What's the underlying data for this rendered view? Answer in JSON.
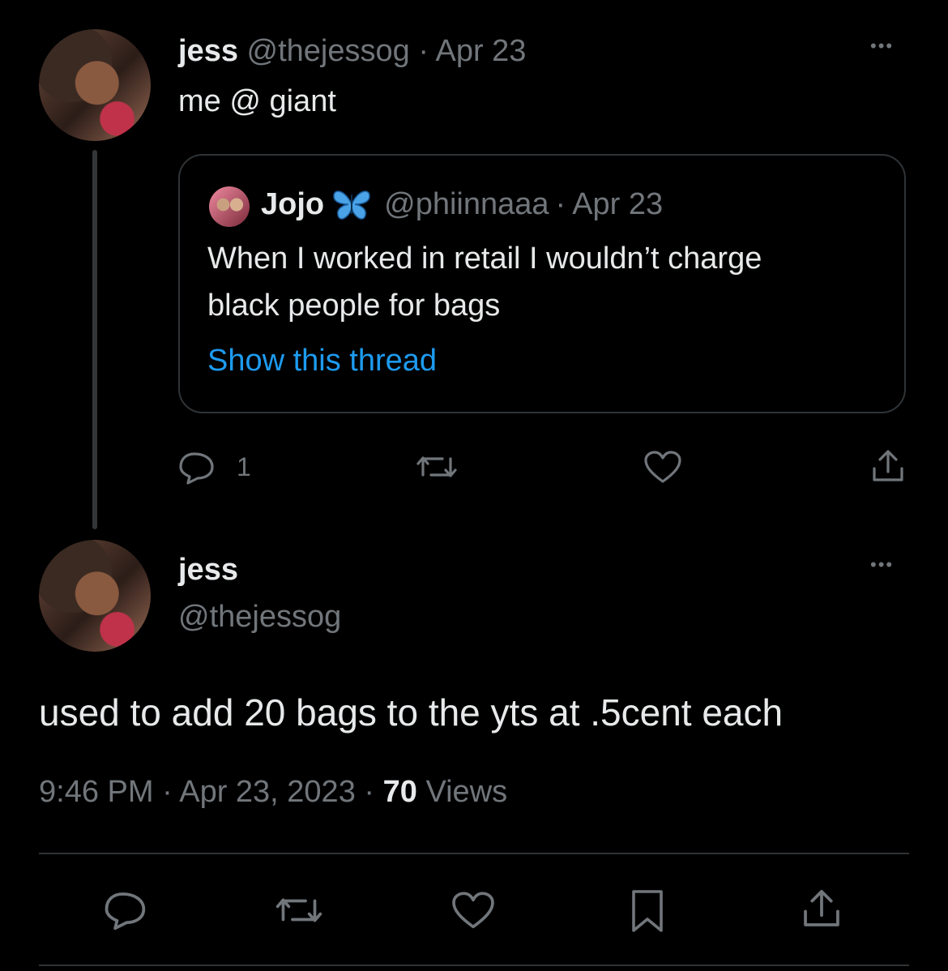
{
  "tweet1": {
    "name": "jess",
    "handle": "@thejessog",
    "sep": "·",
    "date": "Apr 23",
    "text": "me @ giant",
    "more": "•••",
    "quote": {
      "name": "Jojo",
      "handle": "@phiinnaaa",
      "sep": "·",
      "date": "Apr 23",
      "line1": "When I worked in retail I wouldn’t charge",
      "line2": "black people for bags",
      "show_thread": "Show this thread"
    },
    "actions": {
      "reply_count": "1"
    }
  },
  "tweet2": {
    "name": "jess",
    "handle": "@thejessog",
    "more": "•••",
    "text": "used to add 20 bags to the yts at .5cent each",
    "time": "9:46 PM",
    "sep1": "·",
    "date": "Apr 23, 2023",
    "sep2": "·",
    "views_count": "70",
    "views_label": "Views"
  },
  "colors": {
    "background": "#000000",
    "text": "#e7e9ea",
    "muted": "#71767b",
    "link": "#1d9bf0",
    "border": "#2f3336"
  }
}
